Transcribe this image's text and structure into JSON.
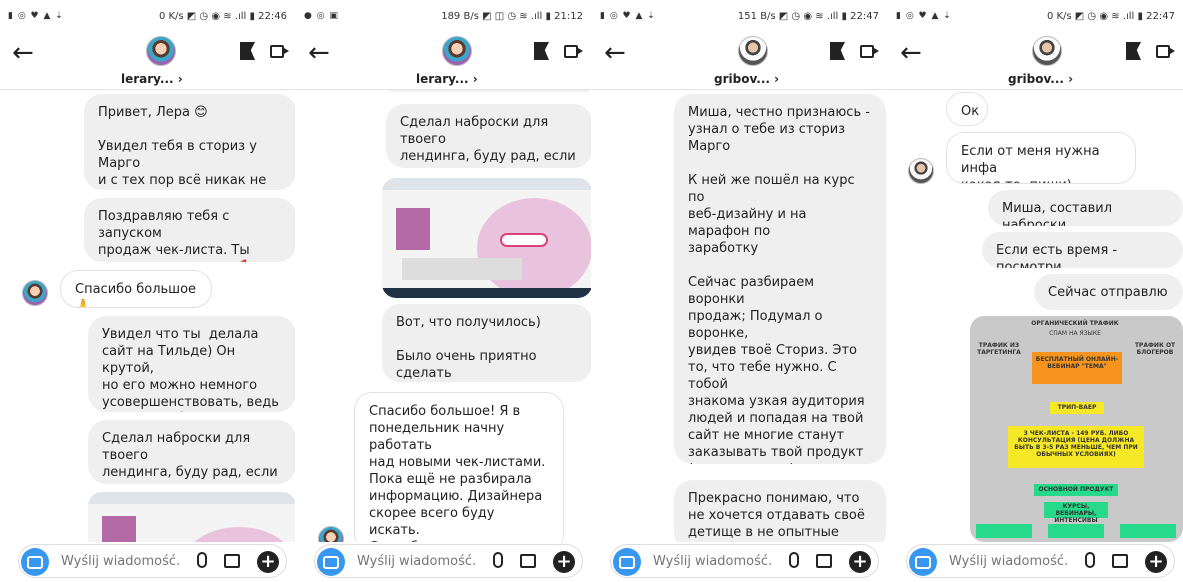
{
  "panels": [
    {
      "status_left": "▮ ◎ ♥ ▲ ⇣",
      "status_right": "0 K/s ◩ ◷ ◉ ≋ .ıll ▮ 22:46",
      "username": "lerary... ›",
      "compose_placeholder": "Wyślij wiadomość...",
      "messages": [
        "Привет, Лера 😊\n\nУвидел тебя в сториз у Марго\nи с тех пор всё никак не могу\nотписаться 😅",
        "Поздравляю тебя с запуском\nпродаж чек-листа. Ты\nогромная молодец 🚀",
        "Спасибо большое🙏",
        "Увидел что ты  делала\nсайт на Тильде) Он крутой,\nно его можно немного\nусовершенствовать, ведь\nтвой чек - 🔥 (сестра купила)",
        "Сделал наброски для твоего\nлендинга, буду рад, если ты\nотреагируешь 😊"
      ]
    },
    {
      "status_left": "● ◎ ▣",
      "status_right": "189 B/s ◩ ◫ ◷ ≋ .ıll ▮ 21:12",
      "username": "lerary... ›",
      "compose_placeholder": "Wyślij wiadomość...",
      "messages": [
        "Сделал наброски для твоего\nлендинга, буду рад, если ты\nотреагируешь 😊",
        "Вот, что получилось)\n\nБыло очень приятно сделать\nчто-то для тебя)",
        "Спасибо большое! Я в\nпонедельник начну работать\nнад новыми чек-листами.\nПока ещё не разбирала\nинформацию. Дизайнера\nскорее всего буду искать.\nСпасибо что написал, а то\nбольшой объём сообщений,\nтеряю, забываю"
      ]
    },
    {
      "status_left": "▮ ◎ ♥ ▲ ⇣",
      "status_right": "151 B/s ◩ ◷ ◉ ≋ .ıll ▮ 22:47",
      "username": "gribov... ›",
      "compose_placeholder": "Wyślij wiadomość...",
      "messages": [
        "Миша, честно признаюсь -\nузнал о тебе из сториз Марго\n\nК ней же пошёл на курс по\nвеб-дизайну и на марафон по\nзаработку\n\nСейчас разбираем воронки\nпродаж; Подумал о воронке,\nувидев твоё Сториз. Это\nто, что тебе нужно. С тобой\nзнакома узкая аудитория\nлюдей и попадая на твой\nсайт не многие станут\nзаказывать твой продукт\n(консультации)\n\nЧто то зажжужало в голове:\n\"блин, надо ему написать\"\n\nПортфолио по воронкам не\nимею, но бесценное желание\nтворить - да",
        "Прекрасно понимаю, что\nне хочется отдавать своё\nдетище в не опытные руки,"
      ]
    },
    {
      "status_left": "▮ ◎ ♥ ▲ ⇣",
      "status_right": "0 K/s ◩ ◷ ◉ ≋ .ıll ▮ 22:47",
      "username": "gribov... ›",
      "compose_placeholder": "Wyślij wiadomość...",
      "messages": [
        "Ок",
        "Если от меня нужна инфа\nкакая-то- пиши)",
        "Миша, составил наброски",
        "Если есть время - посмотри",
        "Сейчас отправлю"
      ],
      "funnel": [
        "ОРГАНИЧЕСКИЙ ТРАФИК",
        "СПАМ НА ЯЗЫКЕ",
        "ТРАФИК ИЗ ТАРГЕТИНГА",
        "ТРАФИК ОТ БЛОГЕРОВ",
        "БЕСПЛАТНЫЙ ОНЛАЙН-ВЕБИНАР \"ТЕМА\"",
        "ТРИП-ВАЕР",
        "3 ЧЕК-ЛИСТА - 149 РУБ. ЛИБО КОНСУЛЬТАЦИЯ (ЦЕНА ДОЛЖНА БЫТЬ В 3-5 РАЗ МЕНЬШЕ, ЧЕМ ПРИ ОБЫЧНЫХ УСЛОВИЯХ)",
        "ОСНОВНОЙ ПРОДУКТ",
        "КУРСЫ, ВЕБИНАРЫ, ИНТЕНСИВЫ"
      ]
    }
  ],
  "colors": {
    "accent": "#3897f0",
    "bubble_gray": "#efefef",
    "webinar_box": "#f7941d",
    "tripwire_box": "#f6e826",
    "product_box": "#27d98a"
  }
}
